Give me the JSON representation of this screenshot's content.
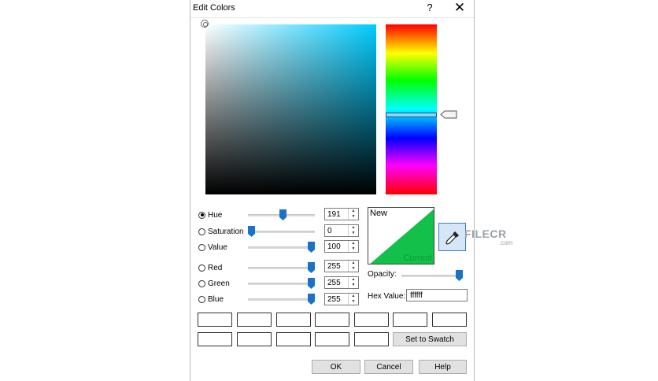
{
  "window": {
    "title": "Edit Colors",
    "help_glyph": "?",
    "close_glyph": "✕"
  },
  "picker": {
    "hue_value": 191,
    "hue_fraction": 0.53,
    "base_color": "#00cbff"
  },
  "controls": {
    "selected_mode": "hue",
    "rows": [
      {
        "id": "hue",
        "label": "Hue",
        "value": "191",
        "fraction": 0.53
      },
      {
        "id": "saturation",
        "label": "Saturation",
        "value": "0",
        "fraction": 0.0
      },
      {
        "id": "value",
        "label": "Value",
        "value": "100",
        "fraction": 1.0
      },
      {
        "id": "red",
        "label": "Red",
        "value": "255",
        "fraction": 1.0
      },
      {
        "id": "green",
        "label": "Green",
        "value": "255",
        "fraction": 1.0
      },
      {
        "id": "blue",
        "label": "Blue",
        "value": "255",
        "fraction": 1.0
      }
    ]
  },
  "preview": {
    "new_label": "New",
    "current_label": "Current",
    "new_color": "#ffffff",
    "current_color": "#13c04a"
  },
  "opacity": {
    "label": "Opacity:",
    "fraction": 1.0
  },
  "hex": {
    "label": "Hex Value:",
    "value": "ffffff"
  },
  "swatches": {
    "set_label": "Set to Swatch"
  },
  "buttons": {
    "ok": "OK",
    "cancel": "Cancel",
    "help": "Help"
  },
  "watermark": {
    "text": "FILECR",
    "sub": ".com"
  },
  "colors": {
    "accent": "#1a73c9",
    "eyedropper_bg": "#d4e6f7"
  }
}
